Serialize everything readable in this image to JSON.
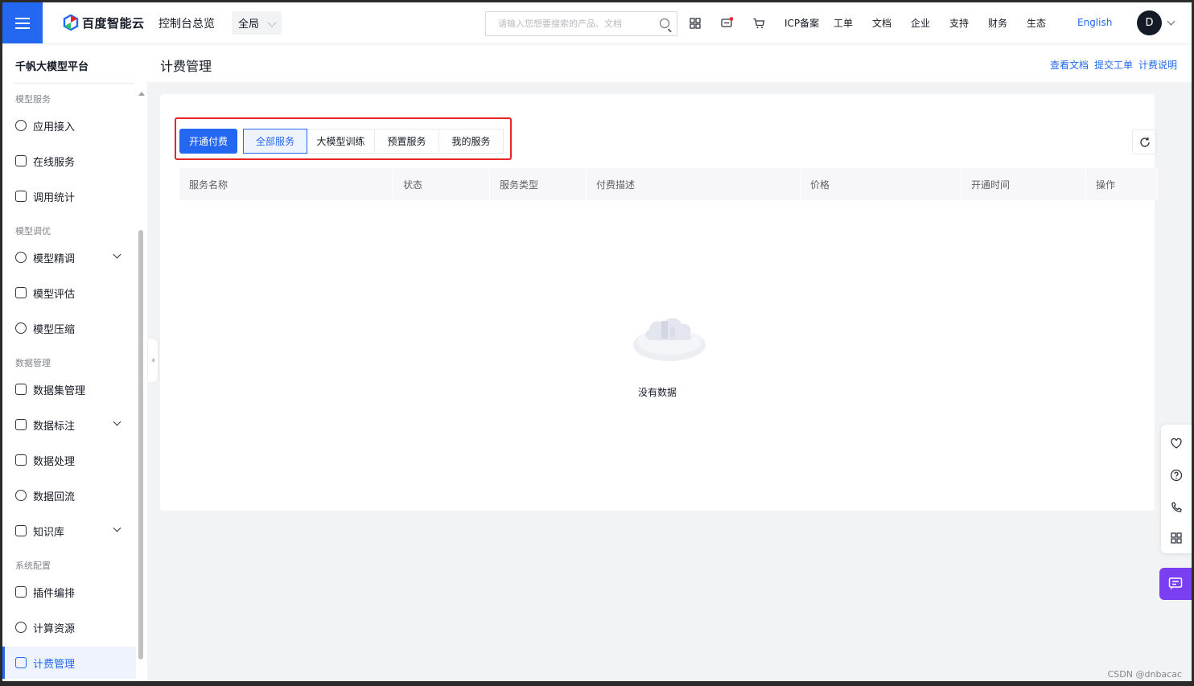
{
  "topbar": {
    "brand": "百度智能云",
    "console_overview": "控制台总览",
    "region": "全局",
    "search_placeholder": "请输入您想要搜索的产品、文档",
    "nav_links": [
      "ICP备案",
      "工单",
      "文档",
      "企业",
      "支持",
      "财务",
      "生态"
    ],
    "language": "English",
    "avatar_initial": "D"
  },
  "sidebar": {
    "title": "千帆大模型平台",
    "groups": [
      {
        "label": "模型服务"
      },
      {
        "label": "模型调优"
      },
      {
        "label": "数据管理"
      },
      {
        "label": "系统配置"
      }
    ],
    "items": [
      {
        "label": "应用接入",
        "icon": "app-access-icon"
      },
      {
        "label": "在线服务",
        "icon": "online-service-icon"
      },
      {
        "label": "调用统计",
        "icon": "stats-icon"
      },
      {
        "label": "模型精调",
        "icon": "fine-tune-icon",
        "expandable": true
      },
      {
        "label": "模型评估",
        "icon": "evaluate-icon"
      },
      {
        "label": "模型压缩",
        "icon": "compress-icon"
      },
      {
        "label": "数据集管理",
        "icon": "dataset-icon"
      },
      {
        "label": "数据标注",
        "icon": "annotate-icon",
        "expandable": true
      },
      {
        "label": "数据处理",
        "icon": "data-process-icon"
      },
      {
        "label": "数据回流",
        "icon": "data-reflow-icon"
      },
      {
        "label": "知识库",
        "icon": "knowledge-base-icon",
        "expandable": true
      },
      {
        "label": "插件编排",
        "icon": "plugin-icon"
      },
      {
        "label": "计算资源",
        "icon": "compute-icon"
      },
      {
        "label": "计费管理",
        "icon": "billing-icon",
        "active": true
      }
    ]
  },
  "page": {
    "title": "计费管理",
    "header_links": [
      "查看文档",
      "提交工单",
      "计费说明"
    ]
  },
  "billing": {
    "enable_button": "开通付费",
    "tabs": [
      {
        "label": "全部服务",
        "active": true
      },
      {
        "label": "大模型训练"
      },
      {
        "label": "预置服务"
      },
      {
        "label": "我的服务"
      }
    ],
    "columns": [
      "服务名称",
      "状态",
      "服务类型",
      "付费描述",
      "价格",
      "开通时间",
      "操作"
    ],
    "rows": [],
    "empty_text": "没有数据"
  },
  "watermark": "CSDN @dnbacac",
  "colors": {
    "primary": "#2468f2",
    "highlight_border": "#e8242c",
    "chat_button": "#7b3ff2"
  }
}
